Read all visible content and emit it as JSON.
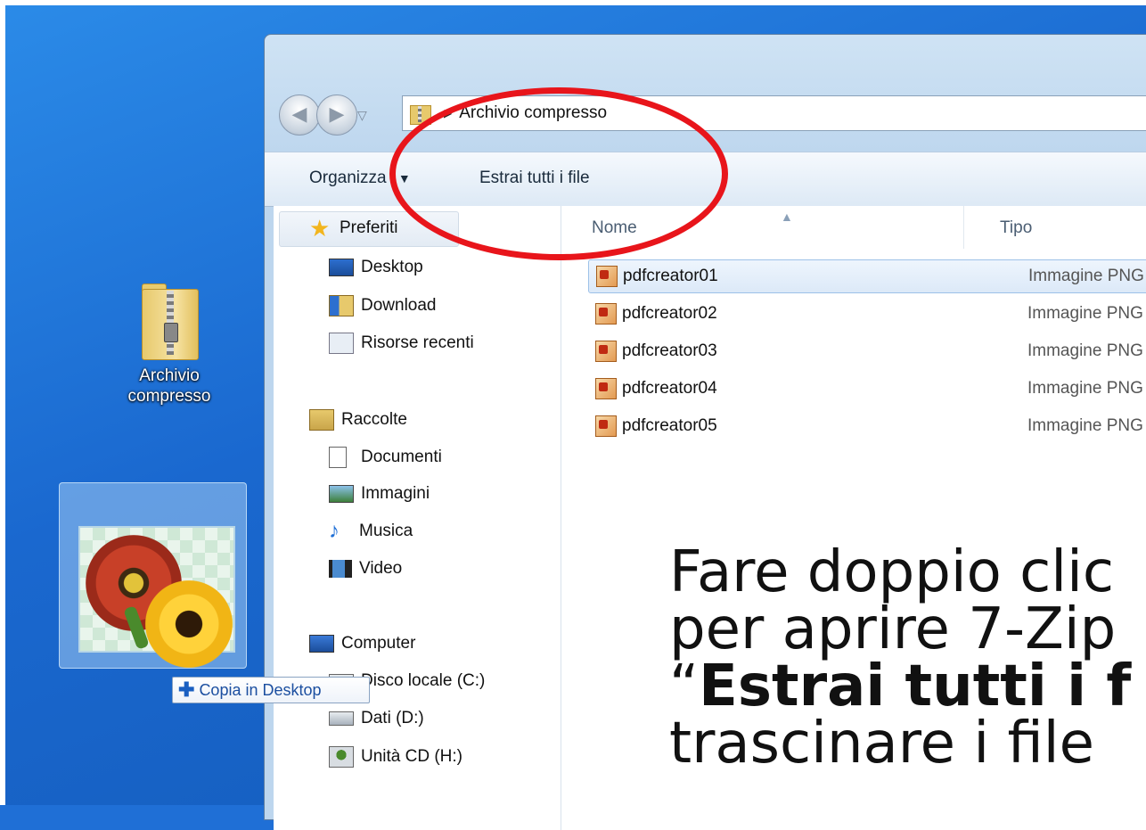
{
  "desktop": {
    "zip_icon_label_line1": "Archivio",
    "zip_icon_label_line2": "compresso",
    "drag_tooltip": "Copia in Desktop"
  },
  "explorer": {
    "address_path": "Archivio compresso",
    "toolbar": {
      "organize_label": "Organizza",
      "extract_label": "Estrai tutti i file"
    },
    "nav_pane": {
      "favorites": {
        "label": "Preferiti",
        "items": [
          "Desktop",
          "Download",
          "Risorse recenti"
        ]
      },
      "libraries": {
        "label": "Raccolte",
        "items": [
          "Documenti",
          "Immagini",
          "Musica",
          "Video"
        ]
      },
      "computer": {
        "label": "Computer",
        "items": [
          "Disco locale (C:)",
          "Dati (D:)",
          "Unità CD (H:)"
        ]
      }
    },
    "columns": {
      "name": "Nome",
      "type": "Tipo"
    },
    "files": [
      {
        "name": "pdfcreator01",
        "type": "Immagine PNG"
      },
      {
        "name": "pdfcreator02",
        "type": "Immagine PNG"
      },
      {
        "name": "pdfcreator03",
        "type": "Immagine PNG"
      },
      {
        "name": "pdfcreator04",
        "type": "Immagine PNG"
      },
      {
        "name": "pdfcreator05",
        "type": "Immagine PNG"
      }
    ]
  },
  "caption": {
    "line1": "Fare doppio clic",
    "line2": "per aprire 7-Zip",
    "line3_quote": "“",
    "line3_bold": "Estrai tutti i f",
    "line4": "trascinare i file"
  },
  "colors": {
    "highlight_ellipse": "#e8151b",
    "desktop_blue": "#1a68cf"
  }
}
